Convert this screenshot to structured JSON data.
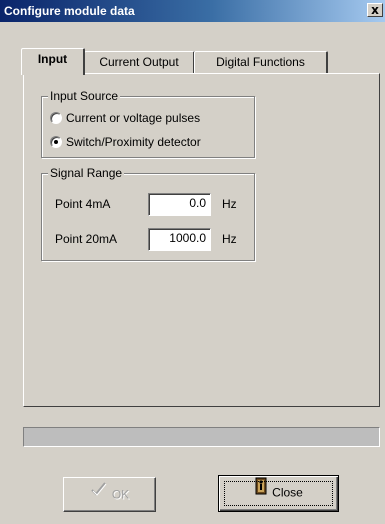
{
  "window": {
    "title": "Configure module data",
    "close_glyph": "x"
  },
  "tabs": [
    {
      "label": "Input",
      "active": true
    },
    {
      "label": "Current Output",
      "active": false
    },
    {
      "label": "Digital Functions",
      "active": false
    }
  ],
  "input_source": {
    "legend": "Input Source",
    "options": [
      {
        "label": "Current or voltage pulses",
        "selected": false
      },
      {
        "label": "Switch/Proximity detector",
        "selected": true
      }
    ]
  },
  "signal_range": {
    "legend": "Signal Range",
    "point_4ma": {
      "label": "Point 4mA",
      "value": "0.0",
      "unit": "Hz"
    },
    "point_20ma": {
      "label": "Point 20mA",
      "value": "1000.0",
      "unit": "Hz"
    }
  },
  "progress": {
    "value": 0
  },
  "buttons": {
    "ok": {
      "label": "OK",
      "enabled": false,
      "icon": "checkmark-icon"
    },
    "close": {
      "label": "Close",
      "enabled": true,
      "icon": "door-exit-icon"
    }
  },
  "colors": {
    "titlebar_start": "#0a246a",
    "titlebar_end": "#a6caf0",
    "face": "#d4d0c8"
  }
}
